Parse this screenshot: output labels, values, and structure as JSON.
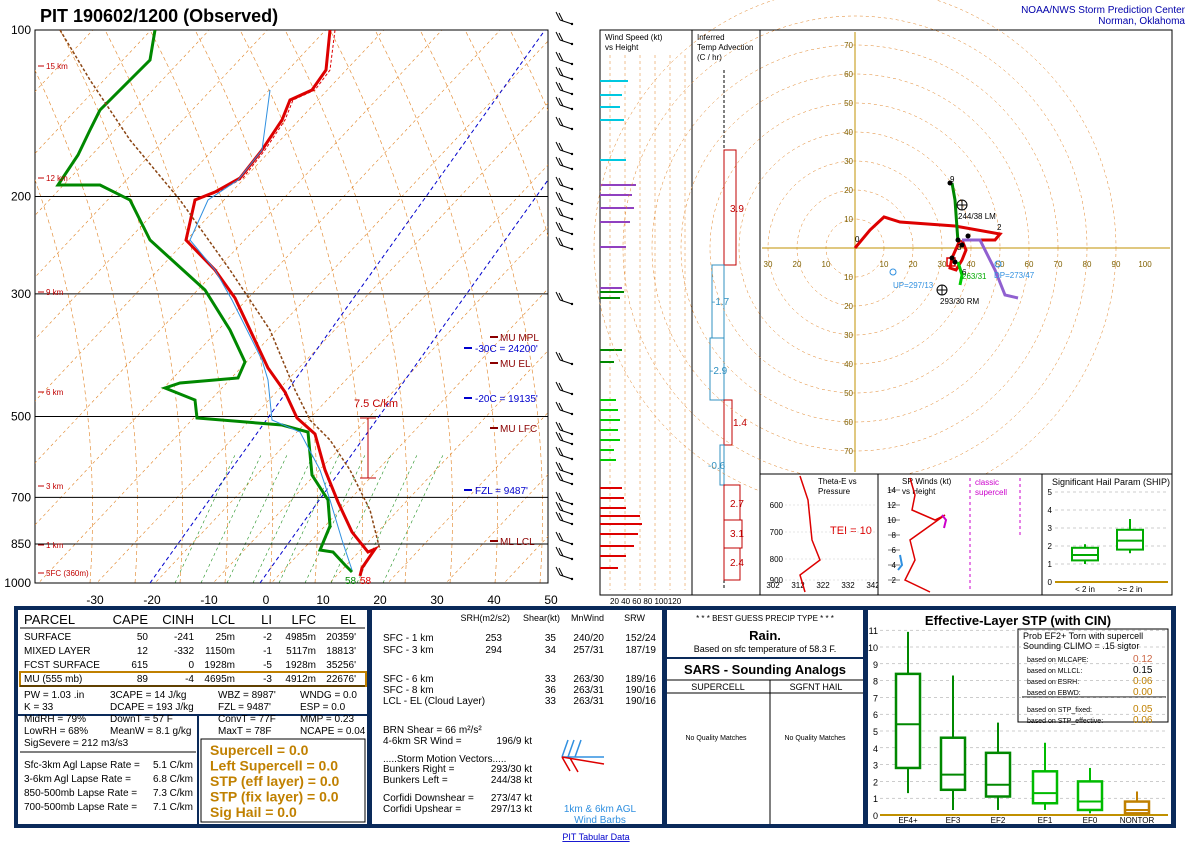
{
  "header": {
    "title": "PIT   190602/1200  (Observed)",
    "org_line1": "NOAA/NWS Storm Prediction Center",
    "org_line2": "Norman, Oklahoma"
  },
  "skewt": {
    "pressure_labels": [
      "100",
      "200",
      "300",
      "500",
      "700",
      "850",
      "1000"
    ],
    "height_labels": [
      "15 km",
      "12 km",
      "9 km",
      "6 km",
      "3 km",
      "1 km",
      "5FC (360m)"
    ],
    "temp_labels": [
      "-30",
      "-20",
      "-10",
      "0",
      "10",
      "20",
      "30",
      "40",
      "50"
    ],
    "annotations": {
      "mu_mpl": "MU  MPL",
      "m30": "-30C = 24200'",
      "mu_el": "MU  EL",
      "m20": "-20C = 19135'",
      "lapse": "7.5 C/km",
      "mu_lfc": "MU  LFC",
      "fzl": "FZL = 9487'",
      "ml_lcl": "ML  LCL",
      "sfc_td": "58",
      "sfc_t": "58"
    }
  },
  "wind_speed_panel": {
    "title1": "Wind Speed (kt)",
    "title2": "vs Height",
    "axis": "20 40 60 80 100120"
  },
  "temp_adv_panel": {
    "title1": "Inferred",
    "title2": "Temp Advection",
    "title3": "(C / hr)",
    "values": [
      "3.9",
      "-1.7",
      "-2.9",
      "1.4",
      "-0.6",
      "2.7",
      "3.1",
      "2.4"
    ]
  },
  "hodograph": {
    "x_labels": [
      "30",
      "20",
      "10",
      "10",
      "20",
      "30",
      "40",
      "50",
      "60",
      "70",
      "80",
      "90",
      "100"
    ],
    "y_labels": [
      "70",
      "60",
      "50",
      "40",
      "30",
      "20",
      "10",
      "10",
      "20",
      "30",
      "40",
      "50",
      "60",
      "70"
    ],
    "points": [
      "0",
      "9",
      "2",
      "3",
      "6"
    ],
    "lm": "244/38 LM",
    "rm": "293/30 RM",
    "up": "UP=297/13",
    "dn": "DP=273/47",
    "sm": "263/31"
  },
  "theta_panel": {
    "title1": "Theta-E vs",
    "title2": "Pressure",
    "tei": "TEI = 10",
    "y_labels": [
      "600",
      "700",
      "800",
      "900"
    ],
    "x_labels": [
      "302",
      "312",
      "322",
      "332",
      "342"
    ]
  },
  "sr_panel": {
    "title1": "SR Winds (kt)",
    "title2": "vs Height",
    "classic1": "classic",
    "classic2": "supercell",
    "y_labels": [
      "14",
      "12",
      "10",
      "8",
      "6",
      "4",
      "2"
    ]
  },
  "ship_panel": {
    "title": "Significant Hail Param (SHIP)",
    "y_labels": [
      "5",
      "4",
      "3",
      "2",
      "1",
      "0"
    ],
    "cats": [
      "< 2 in",
      ">= 2 in"
    ]
  },
  "parcel_table": {
    "headers": [
      "PARCEL",
      "CAPE",
      "CINH",
      "LCL",
      "LI",
      "LFC",
      "EL"
    ],
    "rows": [
      [
        "SURFACE",
        "50",
        "-241",
        "25m",
        "-2",
        "4985m",
        "20359'"
      ],
      [
        "MIXED LAYER",
        "12",
        "-332",
        "1150m",
        "-1",
        "5117m",
        "18813'"
      ],
      [
        "FCST SURFACE",
        "615",
        "0",
        "1928m",
        "-5",
        "1928m",
        "35256'"
      ],
      [
        "MU    (555 mb)",
        "89",
        "-4",
        "4695m",
        "-3",
        "4912m",
        "22676'"
      ]
    ],
    "indices": [
      [
        "PW = 1.03 .in",
        "3CAPE = 14 J/kg",
        "WBZ = 8987'",
        "WNDG = 0.0"
      ],
      [
        "K = 33",
        "DCAPE = 193 J/kg",
        "FZL = 9487'",
        "ESP = 0.0"
      ],
      [
        "MidRH = 79%",
        "DownT = 57 F",
        "ConvT = 77F",
        "MMP = 0.23"
      ],
      [
        "LowRH = 68%",
        "MeanW = 8.1 g/kg",
        "MaxT = 78F",
        "NCAPE = 0.04"
      ]
    ],
    "sigsevere": "SigSevere = 212 m3/s3",
    "lapse_rates": [
      [
        "Sfc-3km Agl Lapse Rate =",
        "5.1 C/km"
      ],
      [
        "3-6km Agl Lapse Rate =",
        "6.8 C/km"
      ],
      [
        "850-500mb Lapse Rate =",
        "7.3 C/km"
      ],
      [
        "700-500mb Lapse Rate =",
        "7.1 C/km"
      ]
    ],
    "composites": [
      "Supercell = 0.0",
      "Left Supercell = 0.0",
      "STP (eff layer) = 0.0",
      "STP (fix layer) = 0.0",
      "Sig Hail = 0.0"
    ]
  },
  "kinematics": {
    "headers": [
      "SRH(m2/s2)",
      "Shear(kt)",
      "MnWind",
      "SRW"
    ],
    "rows": [
      [
        "SFC - 1 km",
        "253",
        "35",
        "240/20",
        "152/24"
      ],
      [
        "SFC - 3 km",
        "294",
        "34",
        "257/31",
        "187/19"
      ],
      [
        "SFC - 6 km",
        "",
        "33",
        "263/30",
        "189/16"
      ],
      [
        "SFC - 8 km",
        "",
        "36",
        "263/31",
        "190/16"
      ],
      [
        "LCL - EL (Cloud Layer)",
        "",
        "33",
        "263/31",
        "190/16"
      ]
    ],
    "brn": "BRN Shear =  66 m²/s²",
    "sr46_label": "4-6km SR Wind =",
    "sr46_val": "196/9 kt",
    "storm_motion": ".....Storm Motion Vectors.....",
    "bunkers_r_label": "Bunkers Right =",
    "bunkers_r": "293/30 kt",
    "bunkers_l_label": "Bunkers Left =",
    "bunkers_l": "244/38 kt",
    "corfidi_d_label": "Corfidi Downshear =",
    "corfidi_d": "273/47 kt",
    "corfidi_u_label": "Corfidi Upshear =",
    "corfidi_u": "297/13 kt",
    "barb_note1": "1km & 6km AGL",
    "barb_note2": "Wind Barbs"
  },
  "precip": {
    "title": "* * * BEST GUESS PRECIP TYPE * * *",
    "value": "Rain.",
    "note": "Based on sfc temperature of 58.3 F."
  },
  "sars": {
    "title": "SARS - Sounding Analogs",
    "col1": "SUPERCELL",
    "col2": "SGFNT HAIL",
    "none1": "No Quality Matches",
    "none2": "No Quality Matches"
  },
  "stp_panel": {
    "title": "Effective-Layer STP (with CIN)",
    "prob1": "Prob EF2+ Torn with supercell",
    "prob2": "Sounding CLIMO = .15 sigtor",
    "rows": [
      [
        "based on MLCAPE:",
        "0.12"
      ],
      [
        "based on MLLCL:",
        "0.15"
      ],
      [
        "based on ESRH:",
        "0.06"
      ],
      [
        "based on EBWD:",
        "0.00"
      ],
      [
        "based on STP_fixed:",
        "0.05"
      ],
      [
        "based on STP_effective:",
        "0.06"
      ]
    ],
    "y_labels": [
      "11",
      "10",
      "9",
      "8",
      "7",
      "6",
      "5",
      "4",
      "3",
      "2",
      "1",
      "0"
    ],
    "cats": [
      "EF4+",
      "EF3",
      "EF2",
      "EF1",
      "EF0",
      "NONTOR"
    ]
  },
  "footer": {
    "link": "PIT Tabular Data"
  },
  "colors": {
    "temp": "#dd0000",
    "dewp": "#008800",
    "navy": "#003366",
    "gold": "#c08000",
    "cyan": "#00c0d0",
    "purple": "#9040c0"
  },
  "chart_data": [
    {
      "type": "line",
      "title": "PIT   190602/1200  (Observed)",
      "xlabel": "",
      "ylabel": "",
      "xlim": [
        -30,
        50
      ],
      "ylim": [
        1000,
        100
      ],
      "series": [
        {
          "name": "",
          "x": [
            21.5,
            19,
            16.5,
            12,
            7,
            2,
            -3,
            -8,
            -18,
            -28,
            -42,
            -55,
            -58
          ],
          "y": [
            1000,
            925,
            850,
            700,
            600,
            500,
            450,
            400,
            300,
            250,
            200,
            150,
            100
          ]
        },
        {
          "name": "",
          "x": [
            16.5,
            14.5,
            12.5,
            7,
            0,
            -6,
            -20,
            -25,
            -45,
            -52,
            -65,
            -72,
            -74
          ],
          "y": [
            1000,
            925,
            850,
            700,
            600,
            500,
            450,
            400,
            300,
            250,
            200,
            150,
            100
          ]
        }
      ]
    },
    {
      "type": "line",
      "title": "",
      "xlabel": "",
      "ylabel": "",
      "xlim": [
        -30,
        100
      ],
      "ylim": [
        -70,
        70
      ],
      "series": [
        {
          "name": "",
          "x": [
            0,
            10,
            18,
            30,
            44,
            34,
            36,
            35,
            30
          ],
          "y": [
            0,
            12,
            10,
            8,
            4,
            -2,
            -5,
            14,
            25
          ],
          "labels": [
            "0",
            "",
            "",
            "",
            "2",
            "3",
            "",
            "6",
            "9"
          ]
        }
      ]
    },
    {
      "type": "bar",
      "title": "",
      "xlabel": "",
      "ylabel": "",
      "categories": [
        "EF4+",
        "EF3",
        "EF2",
        "EF1",
        "EF0",
        "NONTOR"
      ],
      "ylim": [
        0,
        11
      ],
      "series": [
        {
          "name": "",
          "values": [
            [
              1.3,
              2.8,
              5.4,
              8.4,
              10.9
            ],
            [
              0.3,
              1.5,
              2.4,
              4.6,
              8.3
            ],
            [
              0.3,
              1.1,
              1.8,
              3.7,
              5.5
            ],
            [
              0.3,
              0.7,
              1.3,
              2.6,
              4.3
            ],
            [
              0.1,
              0.3,
              0.8,
              2.0,
              2.8
            ],
            [
              0,
              0.1,
              0.3,
              0.8,
              1.4
            ]
          ]
        }
      ]
    },
    {
      "type": "bar",
      "title": "Significant Hail Param (SHIP)",
      "xlabel": "",
      "ylabel": "",
      "categories": [
        "< 2 in",
        ">= 2 in"
      ],
      "ylim": [
        0,
        5
      ],
      "series": [
        {
          "name": "",
          "values": [
            [
              1.0,
              1.2,
              1.5,
              1.9,
              2.1
            ],
            [
              1.6,
              1.8,
              2.3,
              2.9,
              3.5
            ]
          ]
        }
      ]
    }
  ]
}
